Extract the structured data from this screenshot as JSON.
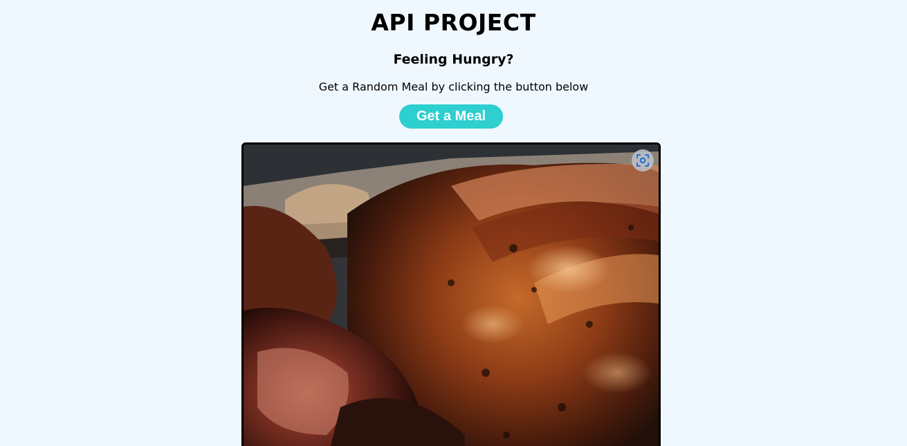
{
  "header": {
    "title": "API PROJECT",
    "heading": "Feeling Hungry?",
    "subtitle": "Get a Random Meal by clicking the button below"
  },
  "actions": {
    "get_meal_label": "Get a Meal"
  },
  "meal": {
    "image_alt": "roasted meat photo",
    "lens_icon": "visual-search-icon"
  },
  "colors": {
    "background": "#f0f8ff",
    "button": "#2dcfcf",
    "button_text": "#ffffff"
  }
}
